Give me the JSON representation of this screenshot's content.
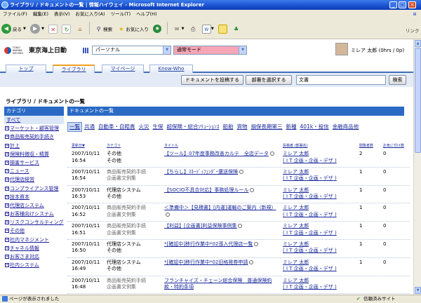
{
  "browser": {
    "title": "ライブラリ / ドキュメントの一覧 | 情報ハイウェイ - Microsoft Internet Explorer",
    "menu": [
      "ファイル(F)",
      "編集(E)",
      "表示(V)",
      "お気に入り(A)",
      "ツール(T)",
      "ヘルプ(H)"
    ],
    "link_label": "リンク",
    "toolbar": {
      "back": "戻る",
      "search": "検索",
      "favorites": "お気に入り"
    },
    "status_left": "ページが表示されました",
    "status_right": "信頼済みサイト"
  },
  "header": {
    "logo_small": "TOKIO MARINE NICHIDO",
    "logo_text": "東京海上日動",
    "portal_select": "パーソナル",
    "mode_select": "通常モード",
    "user_name": "ミレア 太郎",
    "user_counts": "(0hrs / 0p)"
  },
  "tabs": [
    "トップ",
    "ライブラリ",
    "マイページ",
    "Know-Who"
  ],
  "actions": {
    "post_button": "ドキュメントを投稿する",
    "dept_button": "部署を選択する",
    "search_value": "文書",
    "search_button": "検索"
  },
  "breadcrumb": "ライブラリ / ドキュメントの一覧",
  "sidebar": {
    "title": "カテゴリ",
    "all": "すべて",
    "items": [
      "マーケット・顧客管理",
      "商品販売契約手続き",
      "計上",
      "保険料徴収・精算",
      "損害サービス",
      "ニュース",
      "代理店経営",
      "コンプライアンス管理",
      "技本資本",
      "代理店システム",
      "お客様向けシステム",
      "リスクコンサルティング",
      "その他",
      "社内マネジメント",
      "チャネル情報",
      "お客さま対応",
      "社内システム"
    ]
  },
  "doclist": {
    "title": "ドキュメントの一覧",
    "filters": [
      "一覧",
      "共通",
      "自動車・自賠責",
      "火災",
      "生保",
      "超保険・総合ｿﾘｭｰｼｮﾝｽ",
      "船舶",
      "貨物",
      "損保長期第三",
      "新種",
      "401k・投信",
      "金融商品他"
    ],
    "columns": {
      "date": "更新日▼",
      "category": "カテゴリ",
      "title": "タイトル",
      "author": "投稿者 (部署名)",
      "views": "閲覧者数",
      "bookmarks": "お気に付け数"
    },
    "rows": [
      {
        "date": "2007/10/11",
        "time": "16:54",
        "cat1": "その他",
        "cat2": "その他",
        "title": "【ツール】07年度事務改善カルテ　全店データ",
        "author": "ミレア 太郎",
        "dept": "( I T 企画・企画・デザ )",
        "views": "2",
        "bookmarks": "0"
      },
      {
        "date": "2007/10/11",
        "time": "16:54",
        "cat1": "商品販売契約手続",
        "cat2": "企画書文例集",
        "title": "【ちらし】ﾏﾈｰﾃﾞｨﾌｪﾝﾀﾞｰ還送保険",
        "author": "ミレア 太郎",
        "dept": "( I T 企画・企画・デザ )",
        "views": "1",
        "bookmarks": "0"
      },
      {
        "date": "2007/10/11",
        "time": "16:53",
        "cat1": "代理店システム",
        "cat2": "その他",
        "title": "【SOCIO不具合対応】事務処理ルール",
        "author": "ミレア 太郎",
        "dept": "( I T 企画・企画・デザ )",
        "views": "1",
        "bookmarks": "0"
      },
      {
        "date": "2007/10/11",
        "time": "16:52",
        "cat1": "商品販売契約手続",
        "cat2": "企画書文例集",
        "title": "＜準備中＞【見積書】[内運]運輸のご案内（新規）",
        "author": "ミレア 太郎",
        "dept": "( I T 企画・企画・デザ )",
        "views": "1",
        "bookmarks": "0"
      },
      {
        "date": "2007/10/11",
        "time": "16:51",
        "cat1": "商品販売契約手続",
        "cat2": "企画書文例集",
        "title": "【利益】[企画書]利益保険事例集",
        "author": "ミレア 太郎",
        "dept": "( I T 企画・企画・デザ )",
        "views": "1",
        "bookmarks": "0"
      },
      {
        "date": "2007/10/11",
        "time": "16:50",
        "cat1": "代理店システム",
        "cat2": "その他",
        "title": "*[確認中]移行作業中*02導入代理店一覧",
        "author": "ミレア 太郎",
        "dept": "( I T 企画・企画・デザ )",
        "views": "1",
        "bookmarks": "0"
      },
      {
        "date": "2007/10/11",
        "time": "16:49",
        "cat1": "代理店システム",
        "cat2": "その他",
        "title": "*[確認中]移行作業中*02旧格発券申請",
        "author": "ミレア 太郎",
        "dept": "( I T 企画・企画・デザ )",
        "views": "1",
        "bookmarks": "0"
      },
      {
        "date": "2007/10/11",
        "time": "16:48",
        "cat1": "商品販売契約手続",
        "cat2": "企画書文例集",
        "title": "フランチャイズ・チェーン総合保険　普通保険約款・特約条項",
        "author": "ミレア 太郎",
        "dept": "( I T 企画・企画・デザ )",
        "views": "",
        "bookmarks": ""
      }
    ]
  }
}
